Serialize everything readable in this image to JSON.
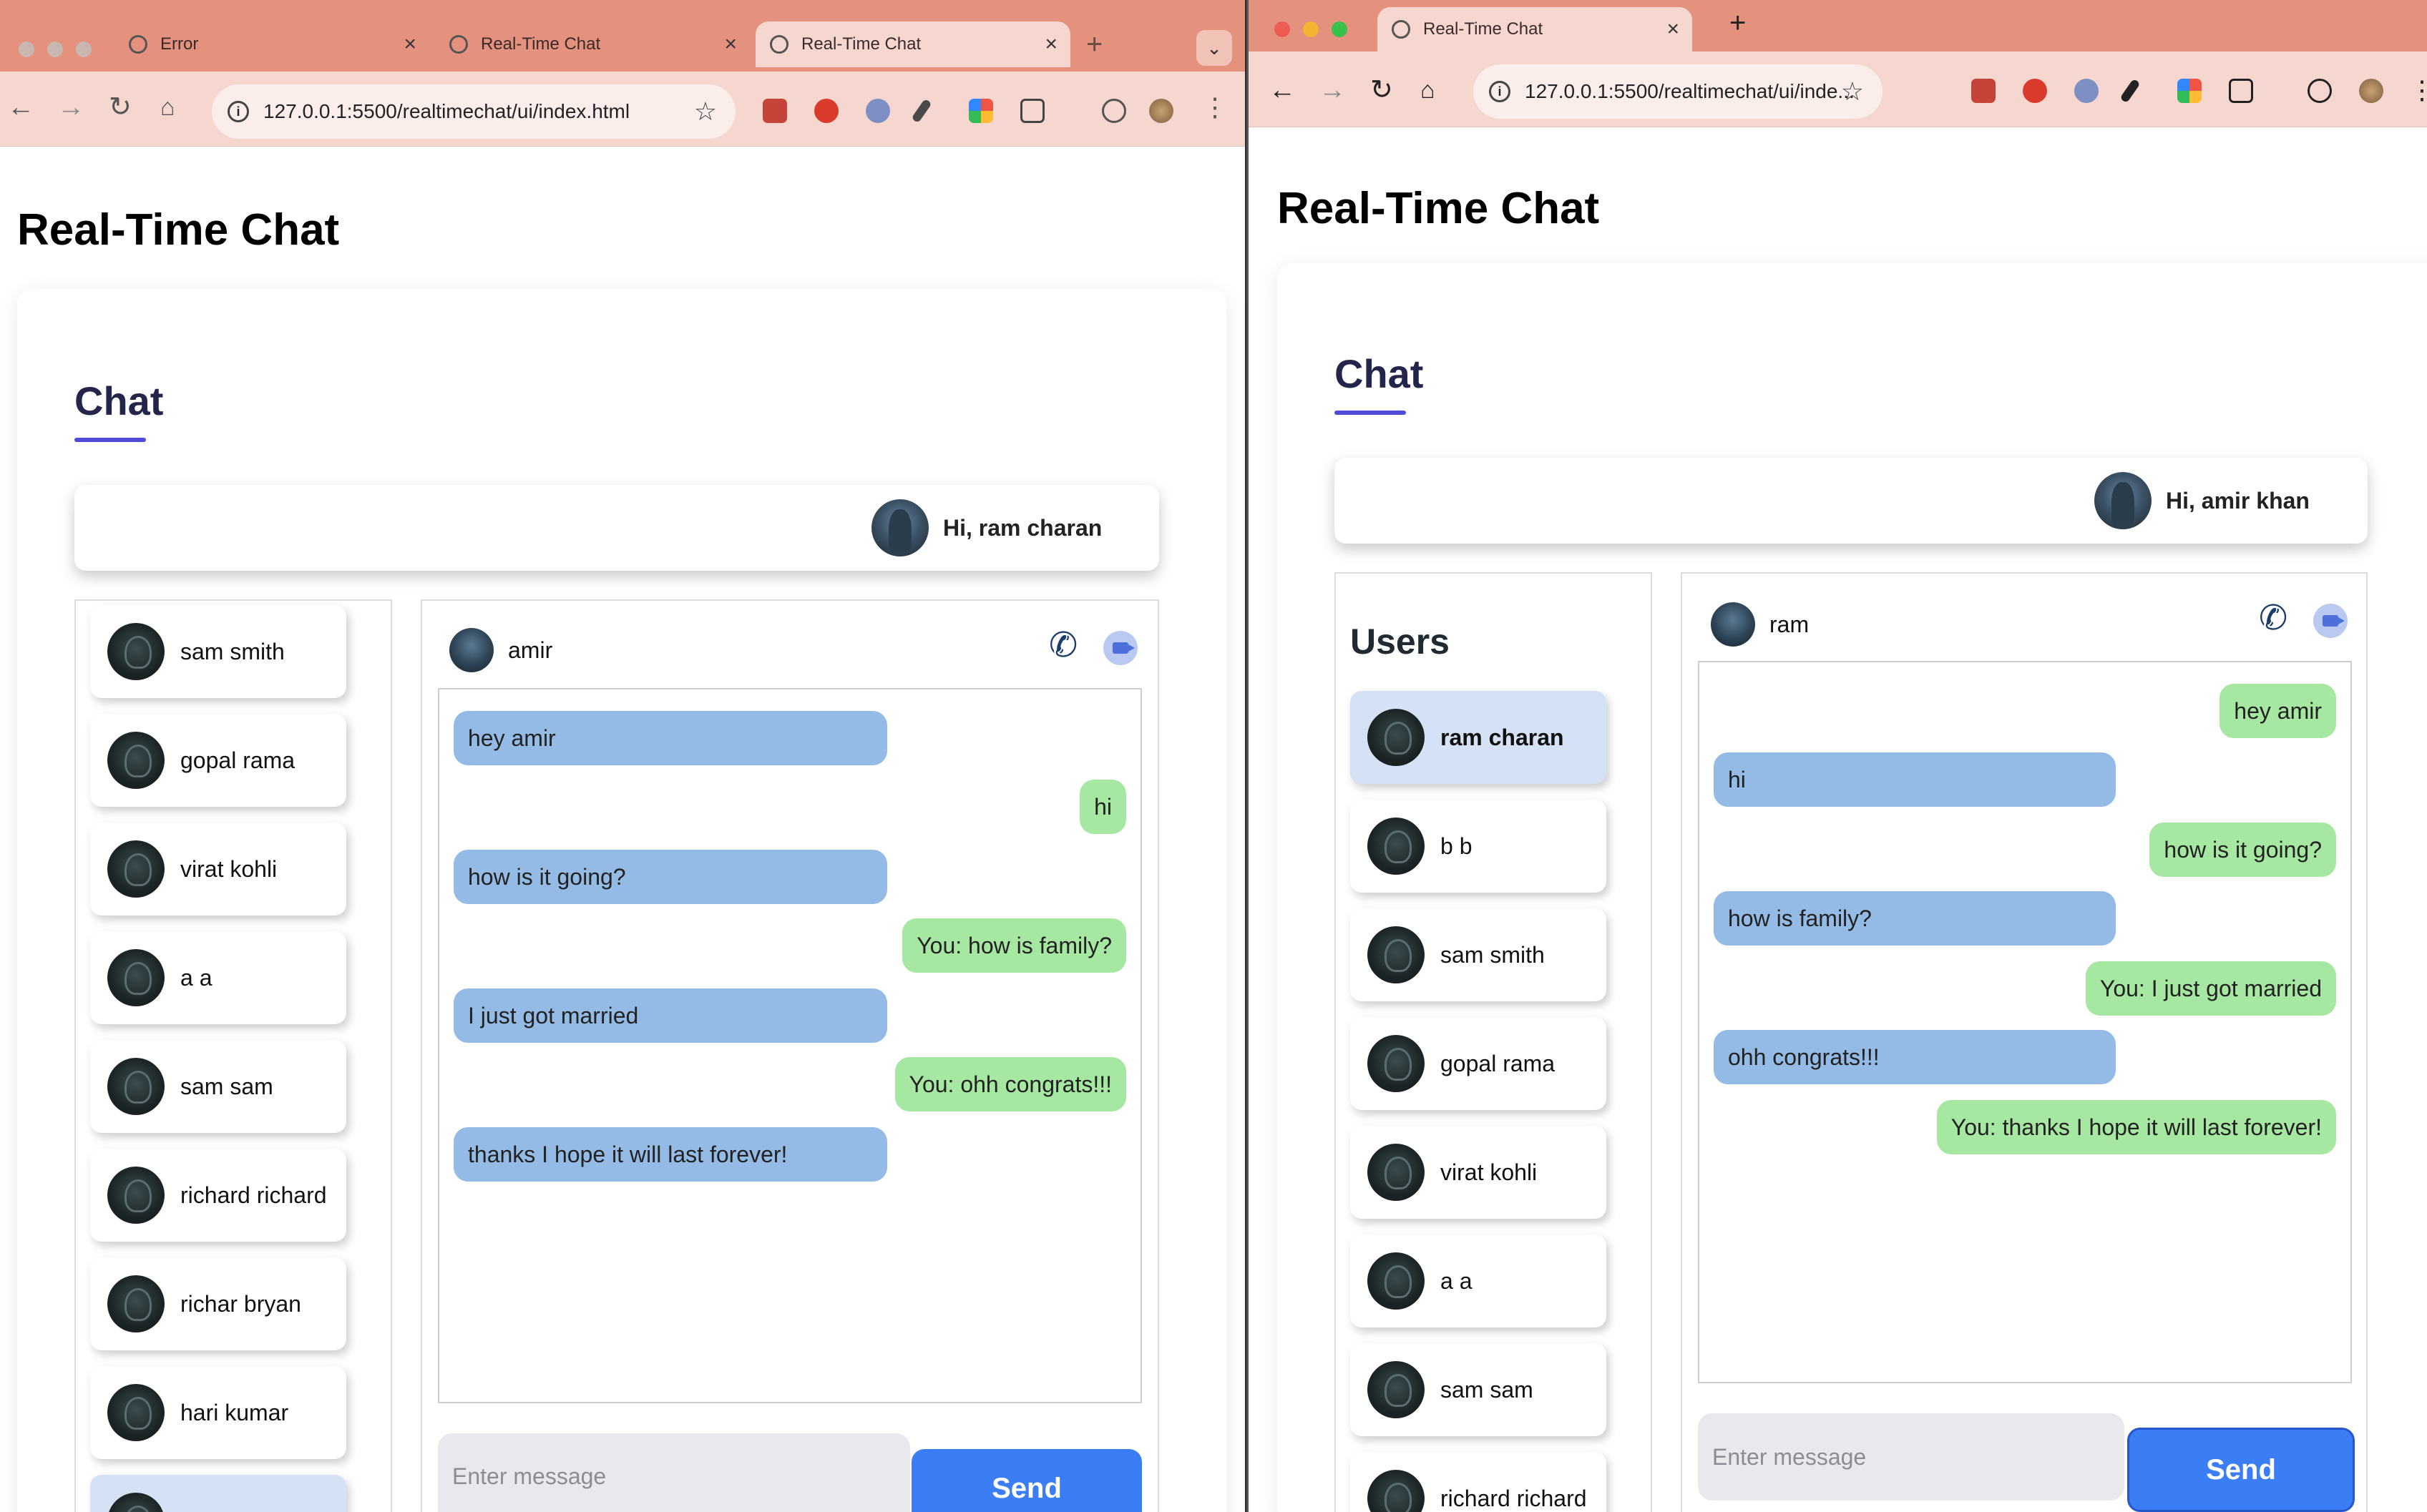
{
  "left": {
    "tabs": [
      {
        "title": "Error"
      },
      {
        "title": "Real-Time Chat"
      },
      {
        "title": "Real-Time Chat"
      }
    ],
    "url": "127.0.0.1:5500/realtimechat/ui/index.html",
    "page_title": "Real-Time Chat",
    "chat_title": "Chat",
    "greeting": "Hi, ram charan",
    "users": [
      {
        "name": "sam smith"
      },
      {
        "name": "gopal rama"
      },
      {
        "name": "virat kohli"
      },
      {
        "name": "a a"
      },
      {
        "name": "sam sam"
      },
      {
        "name": "richard richard"
      },
      {
        "name": "richar bryan"
      },
      {
        "name": "hari kumar"
      },
      {
        "name": ""
      }
    ],
    "contact": "amir",
    "messages": [
      {
        "dir": "in",
        "text": "hey amir"
      },
      {
        "dir": "out",
        "text": "hi"
      },
      {
        "dir": "in",
        "text": "how is it going?"
      },
      {
        "dir": "out",
        "text": "You: how is family?"
      },
      {
        "dir": "in",
        "text": "I just got married"
      },
      {
        "dir": "out",
        "text": "You: ohh congrats!!!"
      },
      {
        "dir": "in",
        "text": "thanks I hope it will last forever!"
      }
    ],
    "input_placeholder": "Enter message",
    "send_label": "Send"
  },
  "right": {
    "tabs": [
      {
        "title": "Real-Time Chat"
      }
    ],
    "url": "127.0.0.1:5500/realtimechat/ui/inde...",
    "page_title": "Real-Time Chat",
    "chat_title": "Chat",
    "greeting": "Hi, amir khan",
    "users_title": "Users",
    "users": [
      {
        "name": "ram charan"
      },
      {
        "name": "b b"
      },
      {
        "name": "sam smith"
      },
      {
        "name": "gopal rama"
      },
      {
        "name": "virat kohli"
      },
      {
        "name": "a a"
      },
      {
        "name": "sam sam"
      },
      {
        "name": "richard richard"
      }
    ],
    "contact": "ram",
    "messages": [
      {
        "dir": "out",
        "text": "hey amir"
      },
      {
        "dir": "in",
        "text": "hi"
      },
      {
        "dir": "out",
        "text": "how is it going?"
      },
      {
        "dir": "in",
        "text": "how is family?"
      },
      {
        "dir": "out",
        "text": "You: I just got married"
      },
      {
        "dir": "in",
        "text": "ohh congrats!!!"
      },
      {
        "dir": "out",
        "text": "You: thanks I hope it will last forever!"
      }
    ],
    "input_placeholder": "Enter message",
    "send_label": "Send"
  },
  "colors": {
    "tabbar": "#e4917e",
    "toolbar": "#f6d7cf",
    "incoming_bubble": "#93bbe6",
    "outgoing_bubble": "#a6e8a2",
    "send_button": "#3b7df5",
    "title_underline": "#4f4bd8"
  },
  "icons": [
    "globe-icon",
    "close-icon",
    "plus-icon",
    "chevron-down-icon",
    "back-icon",
    "forward-icon",
    "reload-icon",
    "home-icon",
    "info-icon",
    "star-icon",
    "pdf-icon",
    "shield-icon",
    "extension-icon",
    "phone-icon",
    "video-icon",
    "avatar"
  ]
}
